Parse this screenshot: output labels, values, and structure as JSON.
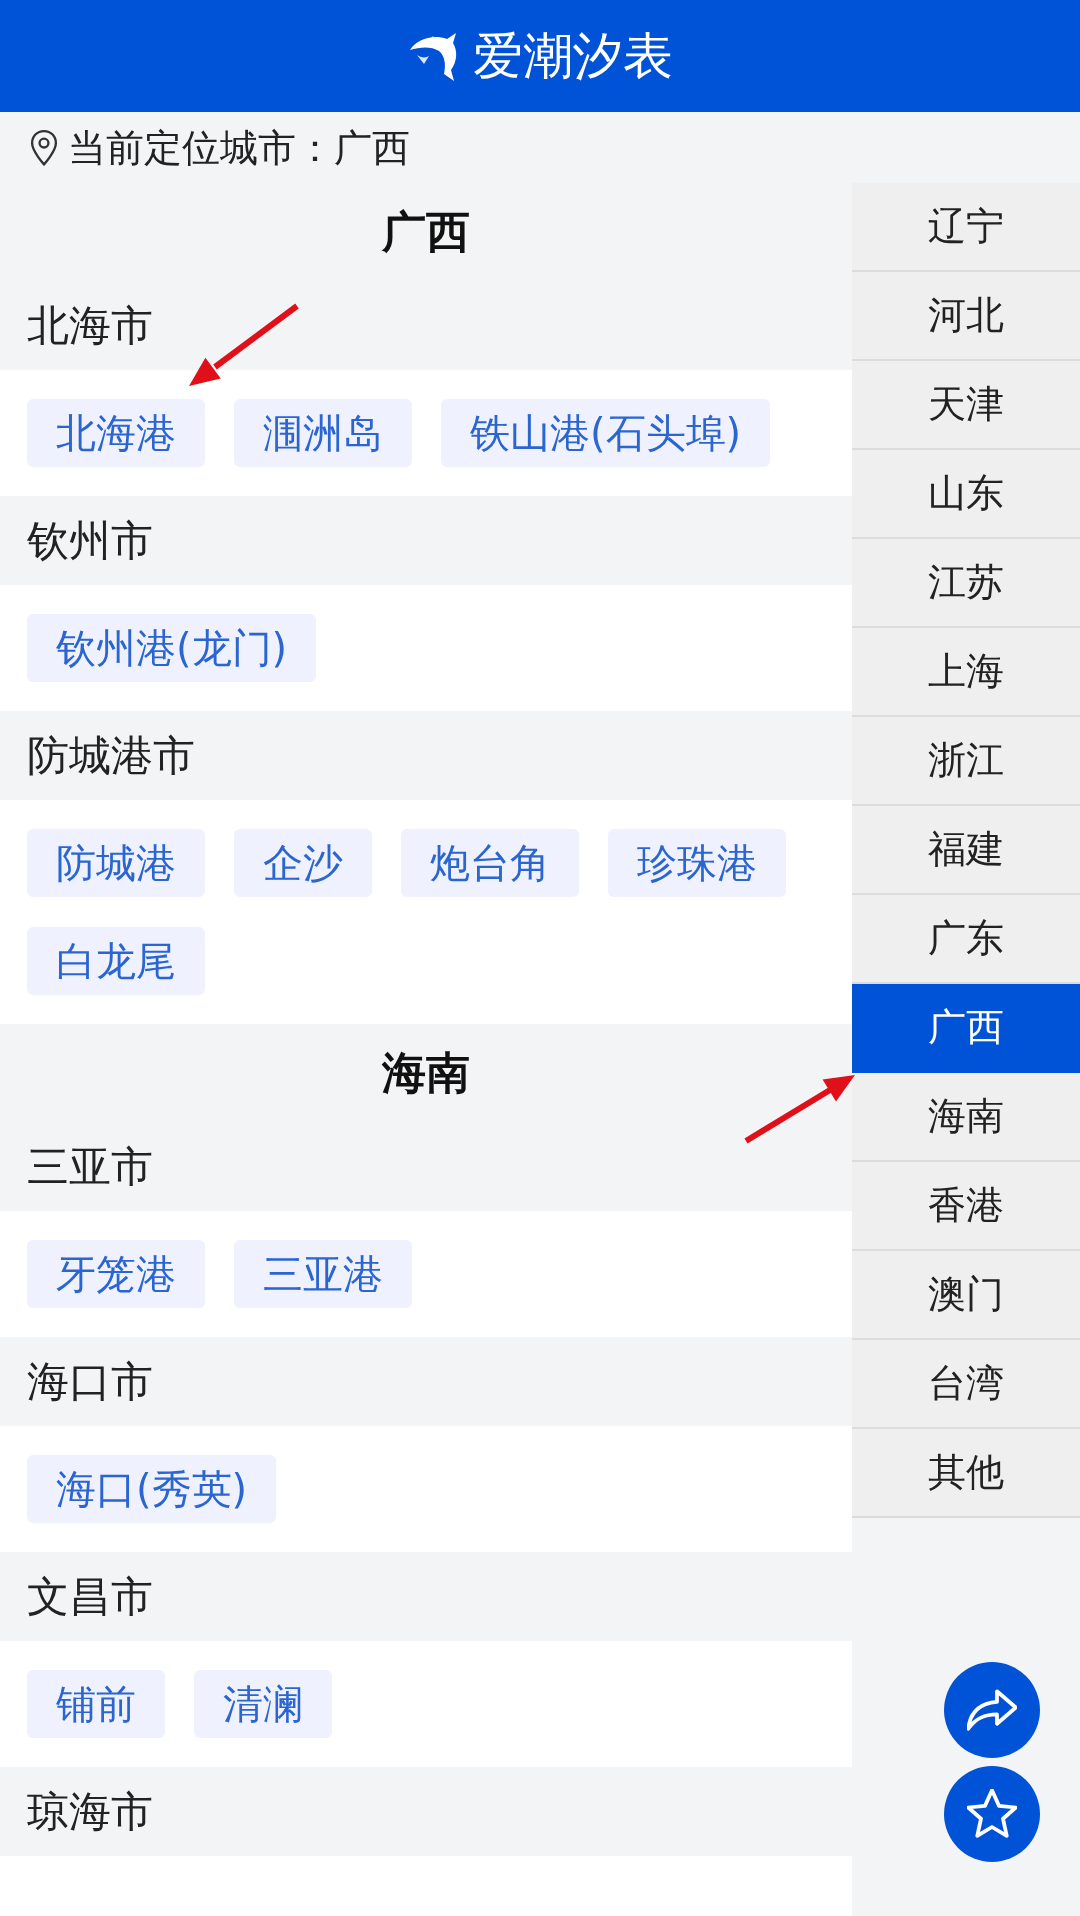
{
  "header": {
    "title": "爱潮汐表"
  },
  "location": {
    "text": "当前定位城市：广西"
  },
  "provinces": [
    {
      "name": "广西",
      "cities": [
        {
          "name": "北海市",
          "ports": [
            {
              "name": "北海港",
              "arrow": true
            },
            {
              "name": "涠洲岛",
              "arrow": false
            },
            {
              "name": "铁山港(石头埠)",
              "arrow": false
            }
          ]
        },
        {
          "name": "钦州市",
          "ports": [
            {
              "name": "钦州港(龙门)",
              "arrow": false
            }
          ]
        },
        {
          "name": "防城港市",
          "ports": [
            {
              "name": "防城港",
              "arrow": false
            },
            {
              "name": "企沙",
              "arrow": false
            },
            {
              "name": "炮台角",
              "arrow": false
            },
            {
              "name": "珍珠港",
              "arrow": false
            },
            {
              "name": "白龙尾",
              "arrow": false
            }
          ]
        }
      ]
    },
    {
      "name": "海南",
      "cities": [
        {
          "name": "三亚市",
          "ports": [
            {
              "name": "牙笼港",
              "arrow": false
            },
            {
              "name": "三亚港",
              "arrow": false
            }
          ]
        },
        {
          "name": "海口市",
          "ports": [
            {
              "name": "海口(秀英)",
              "arrow": false
            }
          ]
        },
        {
          "name": "文昌市",
          "ports": [
            {
              "name": "铺前",
              "arrow": false
            },
            {
              "name": "清澜",
              "arrow": false
            }
          ]
        },
        {
          "name": "琼海市"
        }
      ]
    }
  ],
  "sidebar": {
    "arrow_to_selected": true,
    "items": [
      {
        "label": "辽宁",
        "selected": false
      },
      {
        "label": "河北",
        "selected": false
      },
      {
        "label": "天津",
        "selected": false
      },
      {
        "label": "山东",
        "selected": false
      },
      {
        "label": "江苏",
        "selected": false
      },
      {
        "label": "上海",
        "selected": false
      },
      {
        "label": "浙江",
        "selected": false
      },
      {
        "label": "福建",
        "selected": false
      },
      {
        "label": "广东",
        "selected": false
      },
      {
        "label": "广西",
        "selected": true
      },
      {
        "label": "海南",
        "selected": false
      },
      {
        "label": "香港",
        "selected": false
      },
      {
        "label": "澳门",
        "selected": false
      },
      {
        "label": "台湾",
        "selected": false
      },
      {
        "label": "其他",
        "selected": false
      }
    ]
  },
  "actions": [
    {
      "kind": "share"
    },
    {
      "kind": "favorite"
    }
  ]
}
